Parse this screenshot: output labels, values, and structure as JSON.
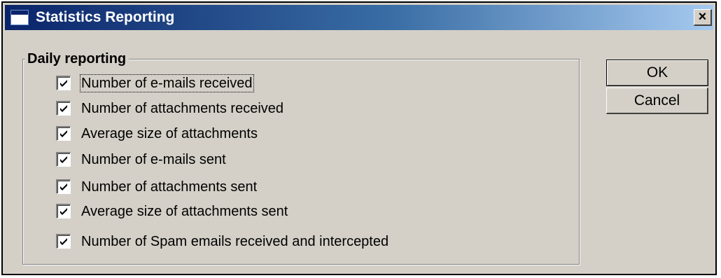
{
  "window": {
    "title": "Statistics Reporting",
    "close_glyph": "×",
    "title_icon": "window-icon"
  },
  "group": {
    "legend": "Daily reporting",
    "items": [
      {
        "label": "Number of e-mails received",
        "checked": true
      },
      {
        "label": "Number of attachments received",
        "checked": true
      },
      {
        "label": "Average size of attachments",
        "checked": true
      },
      {
        "label": "Number of e-mails sent",
        "checked": true
      },
      {
        "label": "Number of attachments sent",
        "checked": true
      },
      {
        "label": "Average size of attachments sent",
        "checked": true
      },
      {
        "label": "Number of Spam emails received and intercepted",
        "checked": true
      }
    ]
  },
  "buttons": {
    "ok": "OK",
    "cancel": "Cancel"
  },
  "colors": {
    "face": "#d4d0c8",
    "title_start": "#0a246a",
    "title_end": "#a6caf0"
  }
}
